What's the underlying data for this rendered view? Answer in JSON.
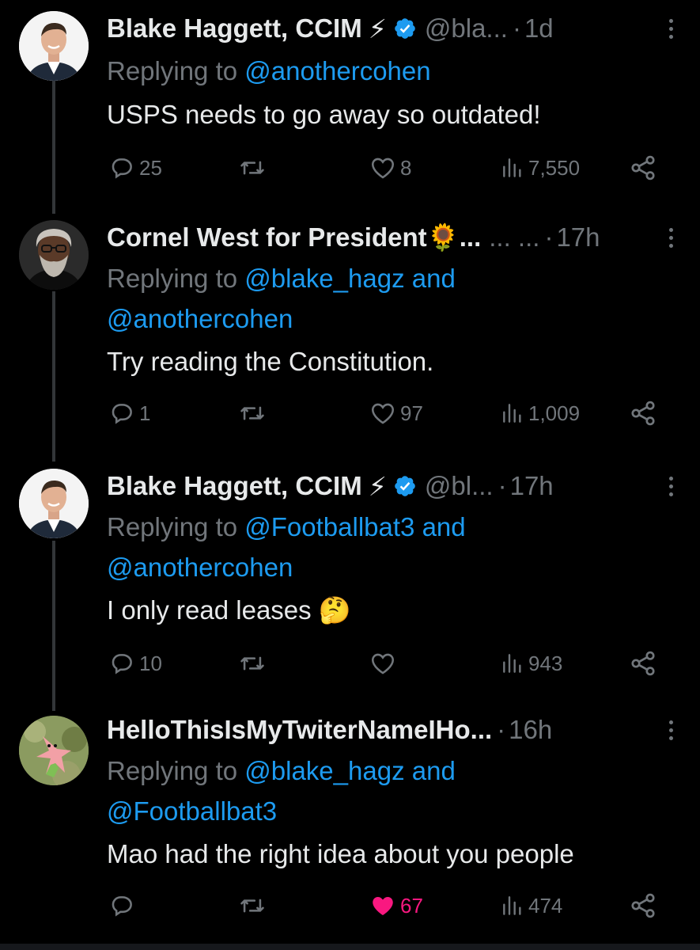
{
  "tweets": [
    {
      "name": "Blake Haggett, CCIM",
      "name_emoji": "⚡",
      "handle": "@bla...",
      "time": "1d",
      "reply_prefix": "Replying to ",
      "reply_line1": "@anothercohen",
      "reply_line1_tail": "",
      "reply_line2": "",
      "text": "USPS needs to go away so outdated!",
      "replies": "25",
      "retweets": "",
      "likes": "8",
      "views": "7,550",
      "liked": false,
      "avatar": "person-suit-photo"
    },
    {
      "name": "Cornel West for President",
      "name_emoji": "🌻",
      "handle": "... ...",
      "time": "17h",
      "reply_prefix": "Replying to ",
      "reply_line1": "@blake_hagz",
      "reply_line1_tail": " and",
      "reply_line2": "@anothercohen",
      "text": "Try reading the Constitution.",
      "replies": "1",
      "retweets": "",
      "likes": "97",
      "views": "1,009",
      "liked": false,
      "avatar": "bearded-man-photo"
    },
    {
      "name": "Blake Haggett, CCIM",
      "name_emoji": "⚡",
      "handle": "@bl...",
      "time": "17h",
      "reply_prefix": "Replying to ",
      "reply_line1": "@Footballbat3",
      "reply_line1_tail": " and",
      "reply_line2": "@anothercohen",
      "text": "I only read leases",
      "text_emoji": "🤔",
      "replies": "10",
      "retweets": "",
      "likes": "",
      "views": "943",
      "liked": false,
      "avatar": "person-suit-photo"
    },
    {
      "name": "HelloThisIsMyTwiterNameIHo...",
      "name_emoji": "",
      "handle": "",
      "time": "16h",
      "reply_prefix": "Replying to ",
      "reply_line1": "@blake_hagz",
      "reply_line1_tail": " and",
      "reply_line2": "@Footballbat3",
      "text": "Mao had the right idea about you people",
      "replies": "",
      "retweets": "",
      "likes": "67",
      "views": "474",
      "liked": true,
      "avatar": "cartoon-starfish-image"
    }
  ],
  "colors": {
    "background": "#000000",
    "text": "#e7e9ea",
    "muted": "#71767b",
    "link": "#1d9bf0",
    "verified": "#1d9bf0",
    "like_active": "#f91880",
    "thread_line": "#333639"
  }
}
